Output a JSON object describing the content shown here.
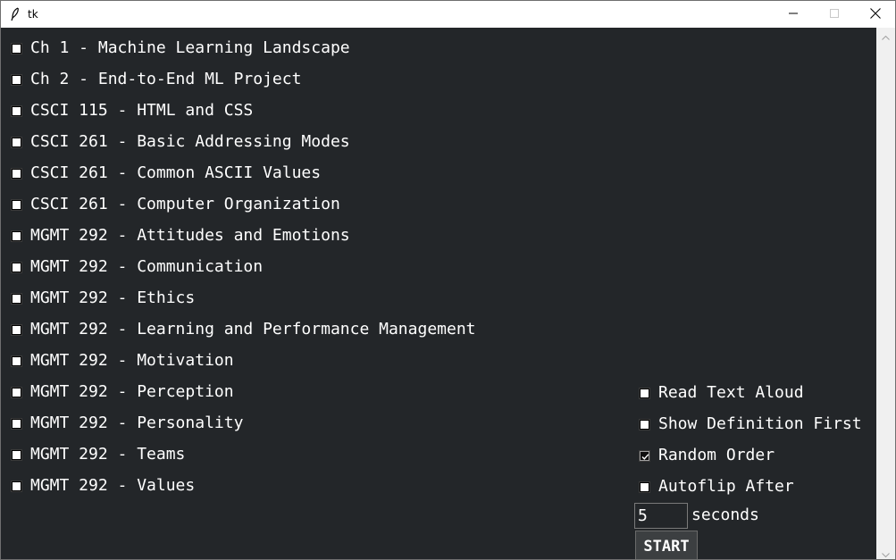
{
  "window": {
    "title": "tk",
    "icons": {
      "app": "feather-icon",
      "minimize": "minimize-icon",
      "maximize": "maximize-icon",
      "close": "close-icon"
    }
  },
  "topics": [
    {
      "label": "Ch 1 - Machine Learning Landscape",
      "checked": false
    },
    {
      "label": "Ch 2 - End-to-End ML Project",
      "checked": false
    },
    {
      "label": "CSCI 115 - HTML and CSS",
      "checked": false
    },
    {
      "label": "CSCI 261 - Basic Addressing Modes",
      "checked": false
    },
    {
      "label": "CSCI 261 - Common ASCII Values",
      "checked": false
    },
    {
      "label": "CSCI 261 - Computer Organization",
      "checked": false
    },
    {
      "label": "MGMT 292 - Attitudes and Emotions",
      "checked": false
    },
    {
      "label": "MGMT 292 - Communication",
      "checked": false
    },
    {
      "label": "MGMT 292 - Ethics",
      "checked": false
    },
    {
      "label": "MGMT 292 - Learning and Performance Management",
      "checked": false
    },
    {
      "label": "MGMT 292 - Motivation",
      "checked": false
    },
    {
      "label": "MGMT 292 - Perception",
      "checked": false
    },
    {
      "label": "MGMT 292 - Personality",
      "checked": false
    },
    {
      "label": "MGMT 292 - Teams",
      "checked": false
    },
    {
      "label": "MGMT 292 - Values",
      "checked": false
    }
  ],
  "options": {
    "read_aloud": {
      "label": "Read Text Aloud",
      "checked": false
    },
    "definition_first": {
      "label": "Show Definition First",
      "checked": false
    },
    "random_order": {
      "label": "Random Order",
      "checked": true
    },
    "autoflip": {
      "label": "Autoflip After",
      "checked": false
    }
  },
  "autoflip": {
    "value": "5",
    "unit_label": "seconds"
  },
  "start_button": {
    "label": "START"
  },
  "colors": {
    "background": "#232629",
    "text": "#ffffff",
    "titlebar": "#ffffff"
  }
}
